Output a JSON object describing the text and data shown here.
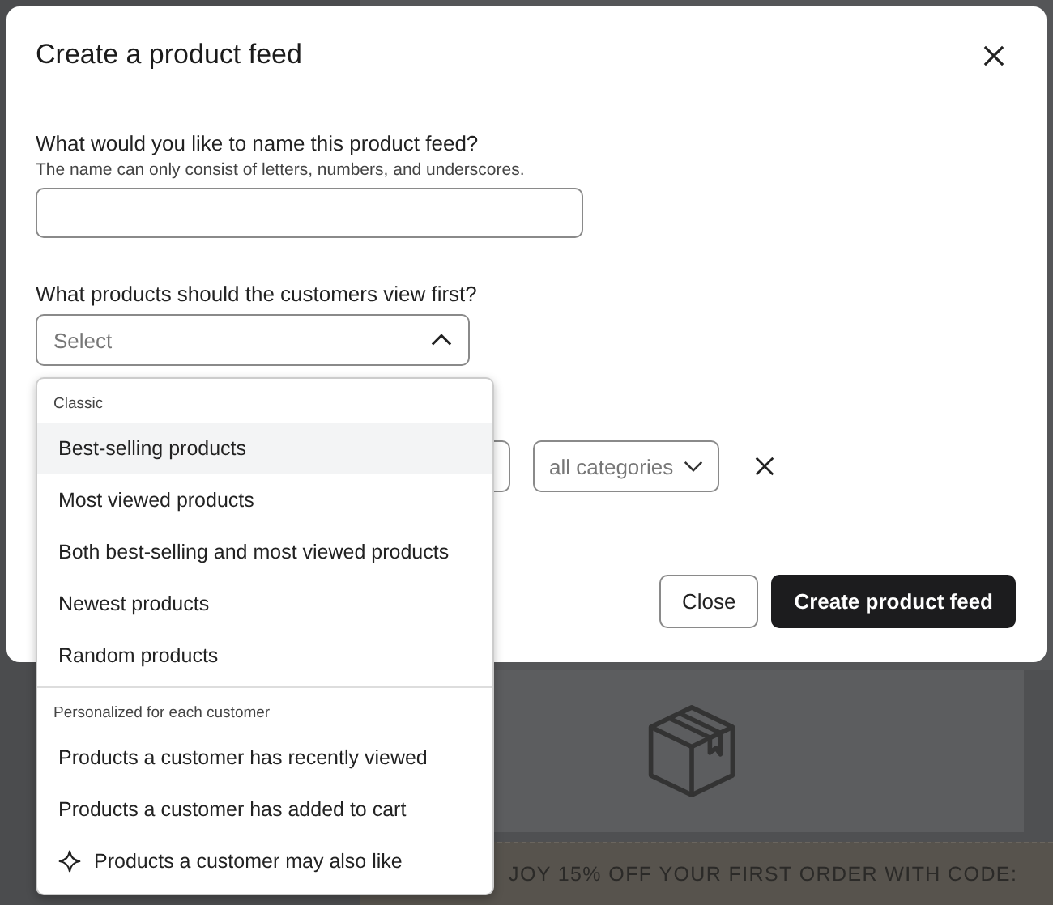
{
  "background_page": {
    "banner": "JOY 15% OFF YOUR FIRST ORDER WITH CODE:"
  },
  "dialog": {
    "title": "Create a product feed",
    "name_field": {
      "label": "What would you like to name this product feed?",
      "hint": "The name can only consist of letters, numbers, and underscores."
    },
    "products_field": {
      "label": "What products should the customers view first?",
      "placeholder": "Select",
      "expanded": true
    },
    "category_select": {
      "value": "all categories"
    },
    "buttons": [
      {
        "label": "Close",
        "kind": "secondary"
      },
      {
        "label": "Create product feed",
        "kind": "primary"
      }
    ]
  },
  "dropdown": {
    "groups": [
      {
        "heading": "Classic",
        "items": [
          {
            "label": "Best-selling products",
            "selected": true,
            "kind": "plain"
          },
          {
            "label": "Most viewed products",
            "selected": false,
            "kind": "plain"
          },
          {
            "label": "Both best-selling and most viewed products",
            "selected": false,
            "kind": "plain"
          },
          {
            "label": "Newest products",
            "selected": false,
            "kind": "plain"
          },
          {
            "label": "Random products",
            "selected": false,
            "kind": "plain"
          }
        ]
      },
      {
        "heading": "Personalized for each customer",
        "items": [
          {
            "label": "Products a customer has recently viewed",
            "selected": false,
            "kind": "plain"
          },
          {
            "label": "Products a customer has added to cart",
            "selected": false,
            "kind": "plain"
          },
          {
            "label": "Products a customer may also like",
            "selected": false,
            "kind": "sparkle"
          }
        ]
      }
    ]
  }
}
